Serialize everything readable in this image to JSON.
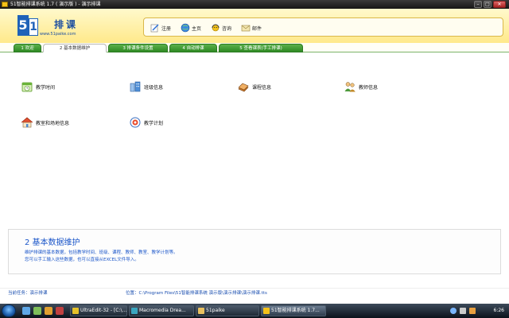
{
  "window": {
    "title": "51智能排课系统 1.7 ( 演示版 ) - 演示排课",
    "minimize_glyph": "–",
    "maximize_glyph": "□",
    "close_glyph": "✕"
  },
  "logo": {
    "digit1": "5",
    "digit2": "1",
    "name": "排课",
    "url": "www.51paike.com"
  },
  "topnav": [
    {
      "label": "注册",
      "icon": "register-pen-icon"
    },
    {
      "label": "主页",
      "icon": "globe-home-icon"
    },
    {
      "label": "咨询",
      "icon": "headset-icon"
    },
    {
      "label": "邮件",
      "icon": "envelope-icon"
    }
  ],
  "tabs": [
    {
      "label": "1 欢迎",
      "active": false
    },
    {
      "label": "2 基本数据维护",
      "active": true
    },
    {
      "label": "3 排课条件设置",
      "active": false
    },
    {
      "label": "4 自动排课",
      "active": false
    },
    {
      "label": "5 查看课表(手工排课)",
      "active": false
    }
  ],
  "items": [
    {
      "label": "教学时间",
      "icon": "clock-calendar-icon"
    },
    {
      "label": "班级信息",
      "icon": "class-building-icon"
    },
    {
      "label": "课程信息",
      "icon": "book-icon"
    },
    {
      "label": "教师信息",
      "icon": "teachers-icon"
    },
    {
      "label": "教室和场地信息",
      "icon": "house-icon"
    },
    {
      "label": "教学计划",
      "icon": "plan-target-icon"
    }
  ],
  "description": {
    "title": "2 基本数据维护",
    "line1": "维护排课的基本数据，包括教学时间、班级、课程、教师、教室、教学计划等。",
    "line2": "您可以手工输入这些数据，也可以直接从EXCEL文件导入。"
  },
  "status": {
    "task": "当前任务：演示排课",
    "location": "位置：C:\\Program Files\\51智能排课系统 演示版\\演示排课\\演示排课.tts"
  },
  "taskbar": {
    "buttons": [
      {
        "label": "UltraEdit-32 - [C:\\...",
        "active": false
      },
      {
        "label": "Macromedia Drea...",
        "active": false
      },
      {
        "label": "51paike",
        "active": false
      },
      {
        "label": "51智能排课系统 1.7...",
        "active": true
      }
    ],
    "clock": "6:26"
  },
  "colors": {
    "tab_green": "#2f8a24",
    "header_yellow": "#ffe98a",
    "desc_blue": "#1b56c9",
    "logo_blue": "#1f62b8"
  }
}
